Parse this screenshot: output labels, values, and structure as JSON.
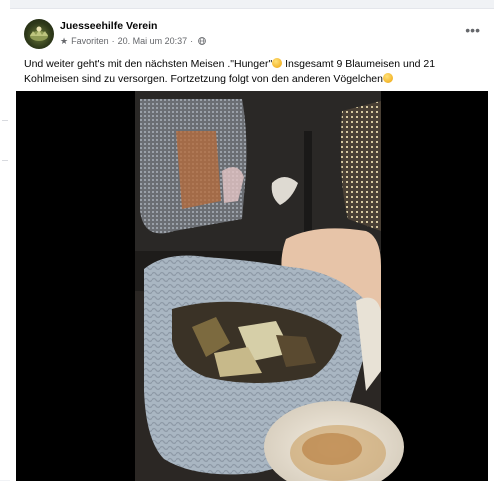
{
  "post": {
    "author": "Juesseehilfe Verein",
    "favorites_label": "Favoriten",
    "separator": "·",
    "date": "20. Mai um 20:37",
    "more_label": "•••",
    "text_part1": "Und weiter geht's mit den nächsten Meisen .\"Hunger\"",
    "text_part2": "Insgesamt 9 Blaumeisen und 21 Kohlmeisen sind zu versorgen. Fortzetzung folgt von den anderen Vögelchen",
    "emoji": "grinning-sweat-face",
    "icons": {
      "favorite": "star-icon",
      "audience": "globe-icon",
      "menu": "more-options-icon"
    }
  },
  "video": {
    "description_colors": {
      "background": "#000000",
      "basket": "#a9b6c2",
      "dish": "#efe9dc"
    }
  }
}
